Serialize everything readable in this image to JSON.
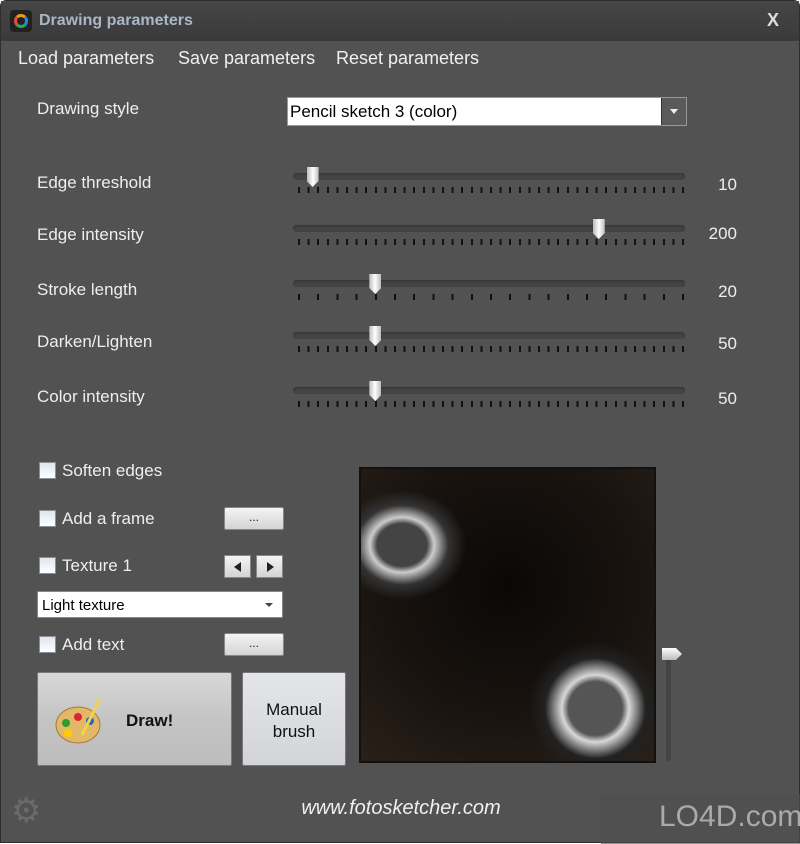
{
  "window": {
    "title": "Drawing parameters",
    "close": "X"
  },
  "menu": [
    "Load parameters",
    "Save parameters",
    "Reset parameters"
  ],
  "drawing_style": {
    "label": "Drawing style",
    "value": "Pencil sketch 3 (color)"
  },
  "sliders": [
    {
      "label": "Edge threshold",
      "value": "10",
      "position": 0.05
    },
    {
      "label": "Edge intensity",
      "value": "200",
      "position": 0.78
    },
    {
      "label": "Stroke length",
      "value": "20",
      "position": 0.21
    },
    {
      "label": "Darken/Lighten",
      "value": "50",
      "position": 0.21
    },
    {
      "label": "Color intensity",
      "value": "50",
      "position": 0.21
    }
  ],
  "options": {
    "soften_edges": {
      "label": "Soften edges",
      "checked": false
    },
    "add_frame": {
      "label": "Add a frame",
      "checked": false,
      "button": "..."
    },
    "texture": {
      "label": "Texture 1",
      "checked": false,
      "select": "Light texture"
    },
    "add_text": {
      "label": "Add text",
      "checked": false,
      "button": "..."
    }
  },
  "buttons": {
    "draw": "Draw!",
    "manual": "Manual brush"
  },
  "footer": {
    "url": "www.fotosketcher.com",
    "watermark": "LO4D.com"
  }
}
